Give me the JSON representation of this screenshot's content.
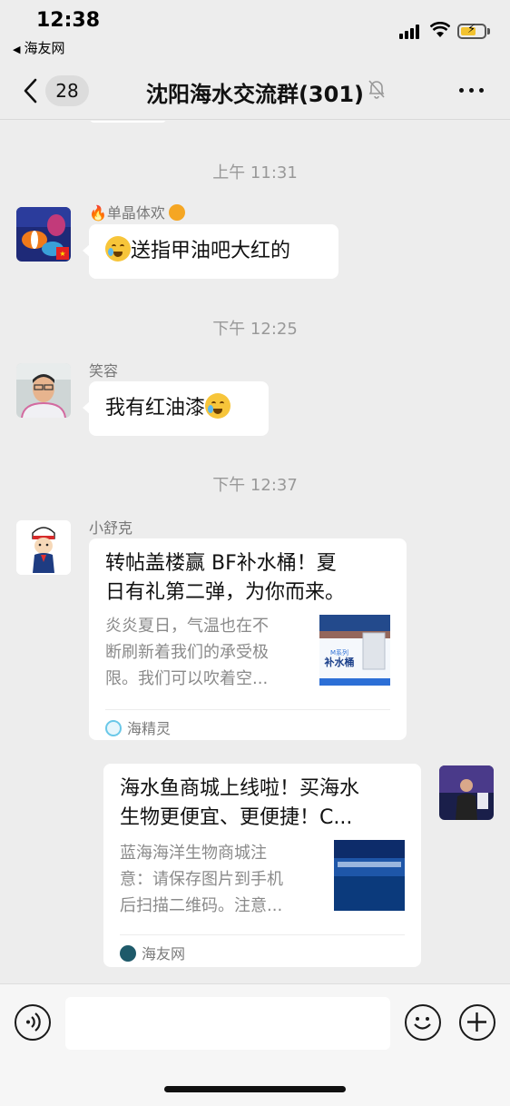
{
  "status_bar": {
    "time": "12:38",
    "back_app": "海友网"
  },
  "header": {
    "unread_count": "28",
    "title": "沈阳海水交流群(301)"
  },
  "messages": [
    {
      "timestamp": "上午 11:31",
      "sender": "单晶体欢",
      "text": "送指甲油吧大红的"
    },
    {
      "timestamp": "下午 12:25",
      "sender": "笑容",
      "text": "我有红油漆"
    },
    {
      "timestamp": "下午 12:37",
      "sender": "小舒克",
      "card": {
        "title_line1": "转帖盖楼赢 BF补水桶！夏",
        "title_line2": "日有礼第二弹，为你而来。",
        "desc_line1": "炎炎夏日，气温也在不",
        "desc_line2": "断刷新着我们的承受极",
        "desc_line3": "限。我们可以吹着空...",
        "thumb_text": "补水桶",
        "source": "海精灵"
      }
    },
    {
      "self": true,
      "card": {
        "title_line1": "海水鱼商城上线啦！买海水",
        "title_line2": "生物更便宜、更便捷！C...",
        "desc_line1": "蓝海海洋生物商城注",
        "desc_line2": "意：请保存图片到手机",
        "desc_line3": "后扫描二维码。注意...",
        "source": "海友网"
      }
    }
  ],
  "colors": {
    "background": "#ededed",
    "bubble": "#ffffff",
    "timestamp": "#999999"
  }
}
